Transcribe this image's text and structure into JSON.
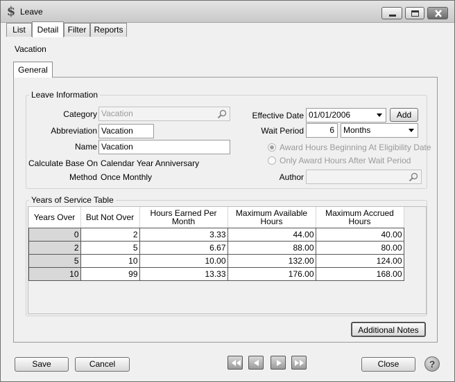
{
  "window": {
    "title": "Leave",
    "app_icon_glyph": "$"
  },
  "tabs": [
    {
      "label": "List"
    },
    {
      "label": "Detail"
    },
    {
      "label": "Filter"
    },
    {
      "label": "Reports"
    }
  ],
  "record_title": "Vacation",
  "subtab": "General",
  "leave_info": {
    "title": "Leave Information",
    "category_label": "Category",
    "category_value": "Vacation",
    "abbreviation_label": "Abbreviation",
    "abbreviation_value": "Vacation",
    "name_label": "Name",
    "name_value": "Vacation",
    "calc_base_label": "Calculate Base On",
    "calc_base_value": "Calendar Year Anniversary",
    "method_label": "Method",
    "method_value": "Once Monthly",
    "effective_date_label": "Effective Date",
    "effective_date_value": "01/01/2006",
    "add_button": "Add",
    "wait_period_label": "Wait Period",
    "wait_period_value": "6",
    "wait_period_unit": "Months",
    "radio_award_beginning": "Award Hours Beginning At Eligibility Date",
    "radio_only_after": "Only Award Hours After Wait Period",
    "author_label": "Author",
    "author_value": ""
  },
  "service_table": {
    "title": "Years of Service Table",
    "columns": [
      "Years Over",
      "But Not Over",
      "Hours Earned Per Month",
      "Maximum Available Hours",
      "Maximum Accrued Hours"
    ],
    "rows": [
      [
        "0",
        "2",
        "3.33",
        "44.00",
        "40.00"
      ],
      [
        "2",
        "5",
        "6.67",
        "88.00",
        "80.00"
      ],
      [
        "5",
        "10",
        "10.00",
        "132.00",
        "124.00"
      ],
      [
        "10",
        "99",
        "13.33",
        "176.00",
        "168.00"
      ]
    ]
  },
  "additional_notes_button": "Additional Notes",
  "footer": {
    "save": "Save",
    "cancel": "Cancel",
    "close": "Close",
    "help_glyph": "?"
  },
  "icons": {
    "category_search": "search-icon",
    "author_search": "search-icon",
    "nav_first": "first-record-icon",
    "nav_prev": "previous-record-icon",
    "nav_next": "next-record-icon",
    "nav_last": "last-record-icon"
  }
}
